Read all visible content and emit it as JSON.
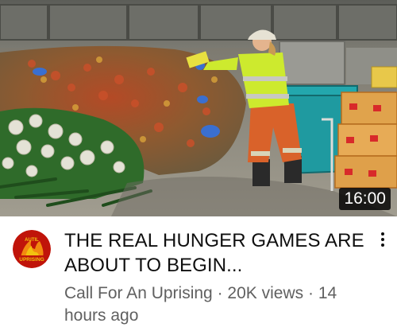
{
  "video": {
    "title": "THE REAL HUNGER GAMES ARE ABOUT TO BEGIN...",
    "duration": "16:00",
    "channel": "Call For An Uprising",
    "separator": "·",
    "views": "20K views",
    "age": "14 hours ago"
  },
  "avatar": {
    "logo_text_top": "AUTIL",
    "logo_text_bottom": "UPRISING"
  },
  "icons": {
    "menu": "more-vert-icon"
  },
  "colors": {
    "title": "#0f0f0f",
    "secondary": "#606060",
    "duration_bg": "#000000",
    "avatar_red": "#c0140a",
    "avatar_yellow": "#f2c20f"
  }
}
